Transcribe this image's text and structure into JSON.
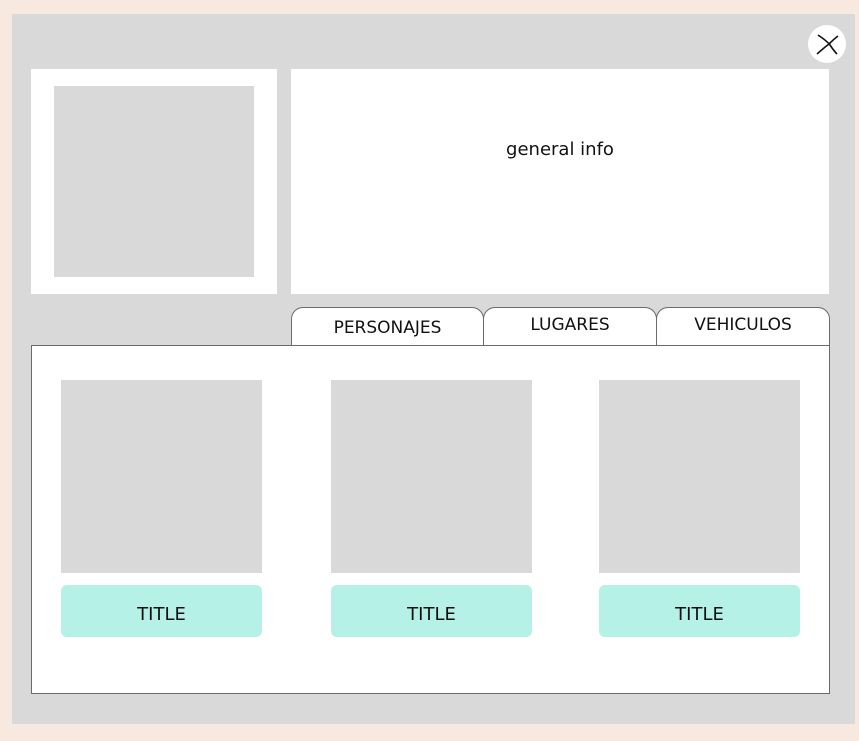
{
  "modal": {
    "close_icon": "close-icon",
    "info": {
      "text": "general info"
    },
    "tabs": [
      {
        "label": "PERSONAJES"
      },
      {
        "label": "LUGARES"
      },
      {
        "label": "VEHICULOS"
      }
    ],
    "cards": [
      {
        "title": "TITLE"
      },
      {
        "title": "TITLE"
      },
      {
        "title": "TITLE"
      }
    ],
    "colors": {
      "page_background": "#f7e9e0",
      "modal_background": "#d9d9d9",
      "panel_background": "#ffffff",
      "placeholder": "#d9d9d9",
      "card_title_background": "#b5f1e6"
    }
  }
}
